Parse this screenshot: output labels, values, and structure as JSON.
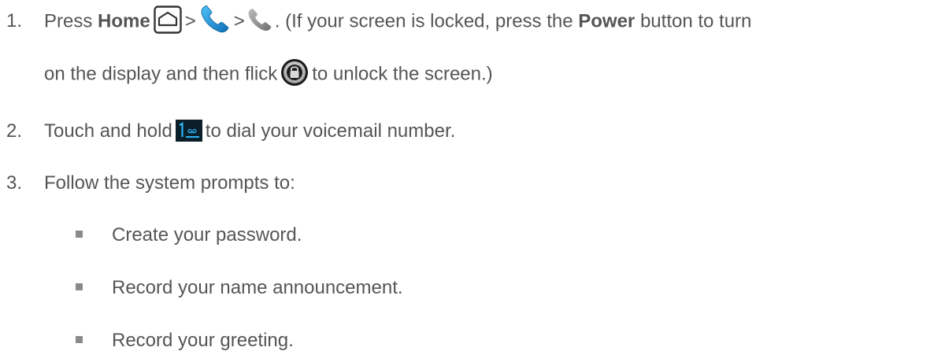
{
  "steps": [
    {
      "number": "1.",
      "press": "Press",
      "home": "Home",
      "sep1": ">",
      "sep2": ">",
      "after_icons": ". (If your screen is locked, press the",
      "power": "Power",
      "after_power": "button to turn",
      "line2_start": "on the display and then flick",
      "line2_end": "to unlock the screen.)"
    },
    {
      "number": "2.",
      "before": "Touch and hold",
      "after": "to dial your voicemail number."
    },
    {
      "number": "3.",
      "text": "Follow the system prompts to:"
    }
  ],
  "bullets": [
    "Create your password.",
    "Record your name announcement.",
    "Record your greeting."
  ],
  "icons": {
    "home": "home-key-icon",
    "phone_app": "phone-app-icon",
    "phone_tab": "phone-tab-icon",
    "unlock": "lock-ring-icon",
    "voicemail_key": "dialpad-1-voicemail-key-icon"
  },
  "colors": {
    "text": "#555555",
    "phone_blue": "#1f8fd6",
    "phone_gray": "#8c8c8c",
    "key_bg": "#0b1f2a",
    "key_blue": "#29b6f6"
  }
}
